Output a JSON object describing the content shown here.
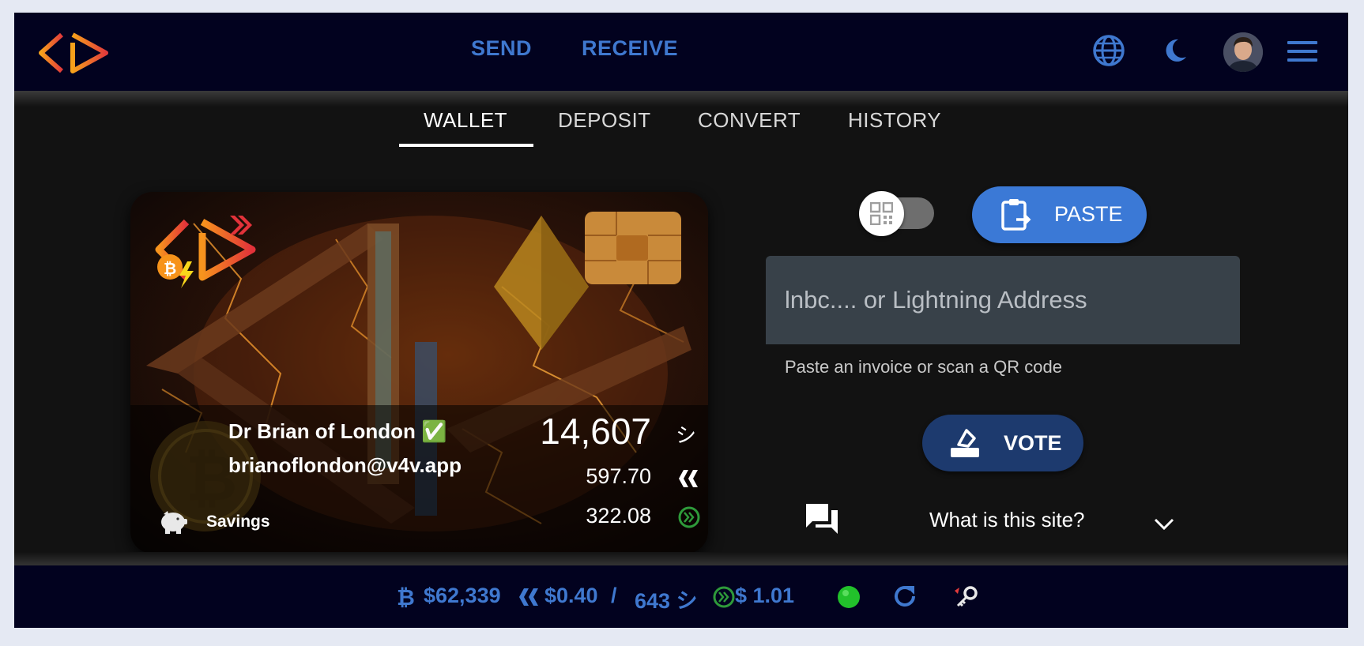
{
  "header": {
    "nav": {
      "send": "SEND",
      "receive": "RECEIVE"
    },
    "icons": [
      "language-icon",
      "dark-mode-icon",
      "avatar",
      "menu-icon"
    ]
  },
  "tabs": [
    {
      "label": "WALLET",
      "active": true
    },
    {
      "label": "DEPOSIT",
      "active": false
    },
    {
      "label": "CONVERT",
      "active": false
    },
    {
      "label": "HISTORY",
      "active": false
    }
  ],
  "card": {
    "display_name": "Dr Brian of London ✅",
    "address": "brianoflondon@v4v.app",
    "savings_label": "Savings",
    "balance_sats": "14,607",
    "sats_symbol": "シ",
    "balance_hive": "597.70",
    "balance_hbd": "322.08"
  },
  "send_form": {
    "qr_toggle_on": false,
    "paste_label": "PASTE",
    "input_placeholder": "lnbc.... or Lightning Address",
    "input_value": "",
    "helper_text": "Paste an invoice or scan a QR code",
    "vote_label": "VOTE",
    "faq_question": "What is this site?"
  },
  "footer": {
    "btc_price": "$62,339",
    "hive_price": "$0.40",
    "separator": "/",
    "hive_sats": "643 シ",
    "hbd_price": "$ 1.01",
    "status": "green"
  },
  "colors": {
    "accent": "#3f78cf",
    "appbar": "#02021f",
    "background": "#121212",
    "paste_button": "#3b79d6",
    "vote_button": "#1d3a6e",
    "hbd_green": "#2e9a3a",
    "status_green": "#22c12b"
  }
}
